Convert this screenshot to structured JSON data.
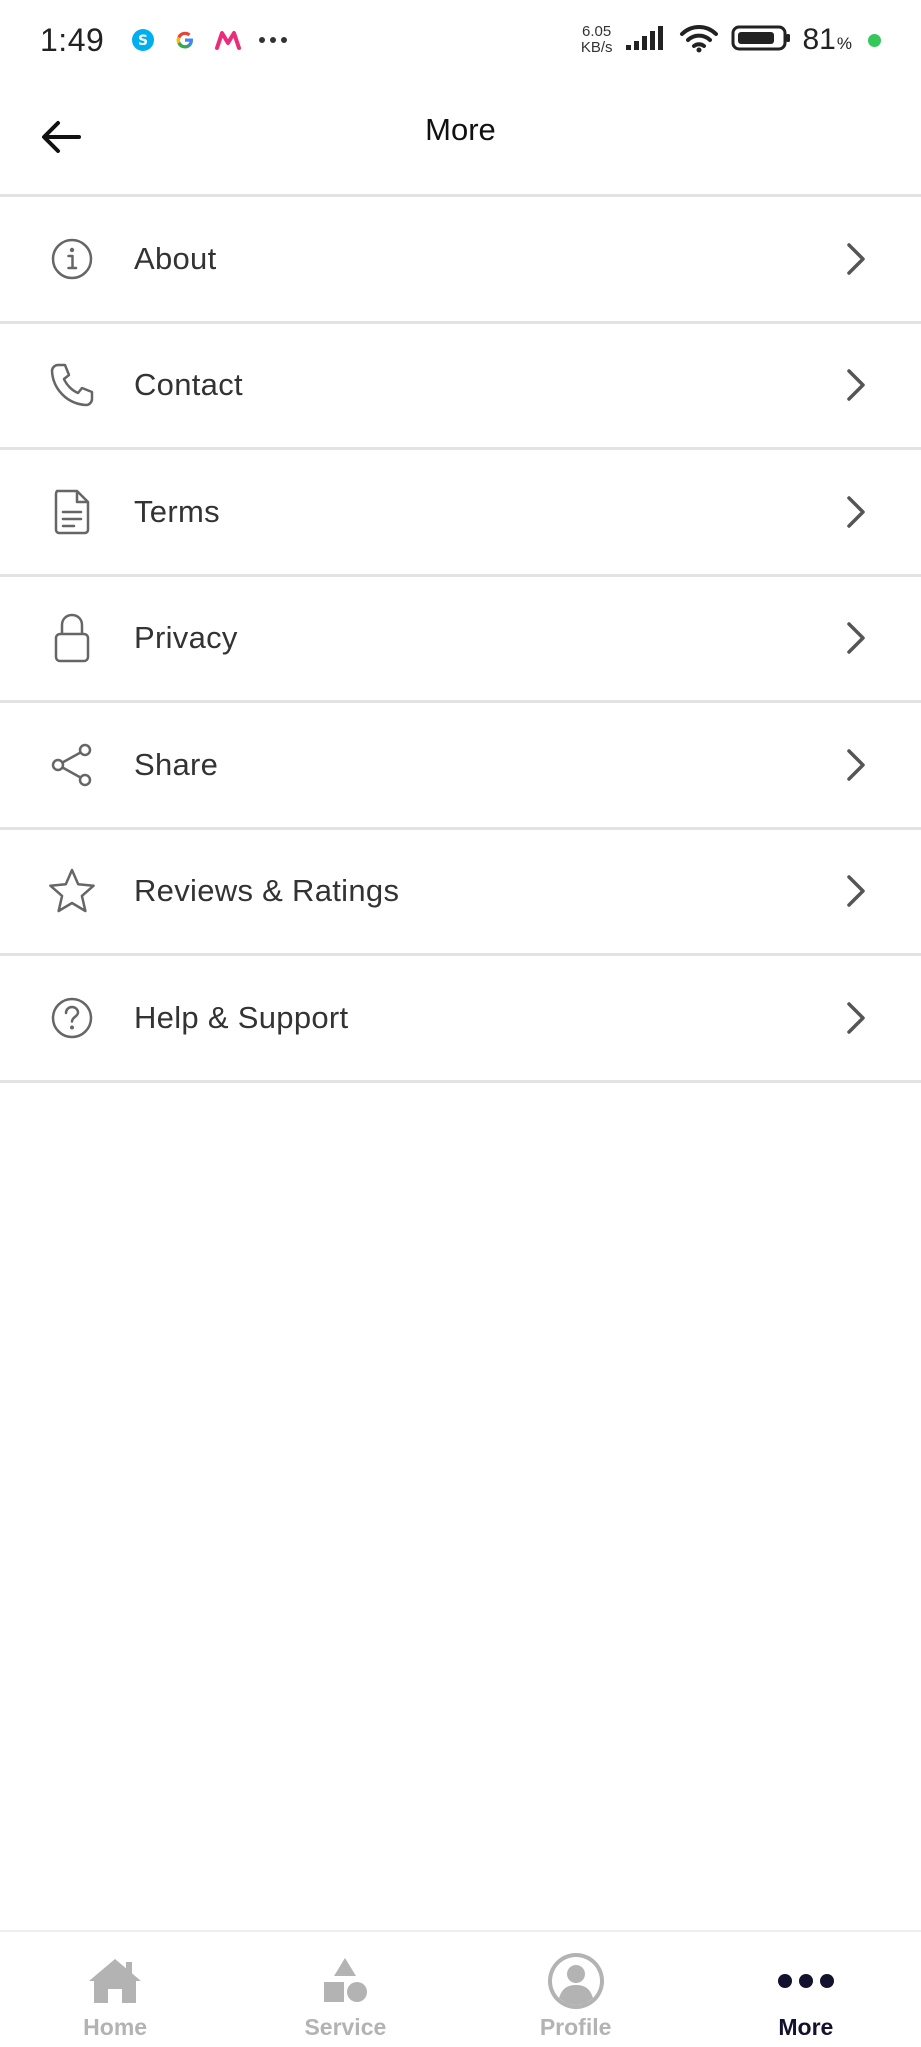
{
  "status_bar": {
    "time": "1:49",
    "net_speed_value": "6.05",
    "net_speed_unit": "KB/s",
    "battery_percent": "81",
    "battery_unit": "%",
    "notification_icons": [
      "skype-icon",
      "google-icon",
      "myntra-icon",
      "more-dots-icon"
    ],
    "colors": {
      "skype": "#00aff0",
      "myntra": "#ee2a7b",
      "charging_dot": "#34c759"
    }
  },
  "header": {
    "title": "More",
    "back_icon": "arrow-left-icon"
  },
  "menu": {
    "items": [
      {
        "label": "About",
        "icon": "info-icon"
      },
      {
        "label": "Contact",
        "icon": "phone-icon"
      },
      {
        "label": "Terms",
        "icon": "document-icon"
      },
      {
        "label": "Privacy",
        "icon": "lock-icon"
      },
      {
        "label": "Share",
        "icon": "share-icon"
      },
      {
        "label": "Reviews & Ratings",
        "icon": "star-icon"
      },
      {
        "label": "Help & Support",
        "icon": "help-icon"
      }
    ],
    "chevron_icon": "chevron-right-icon"
  },
  "bottom_nav": {
    "items": [
      {
        "label": "Home",
        "icon": "home-icon",
        "active": false
      },
      {
        "label": "Service",
        "icon": "shapes-icon",
        "active": false
      },
      {
        "label": "Profile",
        "icon": "user-icon",
        "active": false
      },
      {
        "label": "More",
        "icon": "dots-icon",
        "active": true
      }
    ],
    "colors": {
      "active": "#12122e",
      "inactive": "#b3b3b3"
    }
  }
}
